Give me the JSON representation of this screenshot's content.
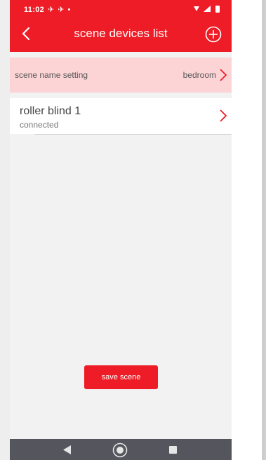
{
  "status_bar": {
    "time": "11:02",
    "left_icons": "✈ ✈ •"
  },
  "header": {
    "title": "scene devices list",
    "back_icon": "chevron-left-icon",
    "add_icon": "plus-circle-icon"
  },
  "scene_setting": {
    "label": "scene name setting",
    "value": "bedroom"
  },
  "devices": [
    {
      "name": "roller blind 1",
      "status": "connected"
    }
  ],
  "actions": {
    "save_label": "save scene"
  },
  "colors": {
    "accent": "#ee1c26",
    "scene_row_bg": "#fdd4d6",
    "nav_bar": "#55555d"
  }
}
